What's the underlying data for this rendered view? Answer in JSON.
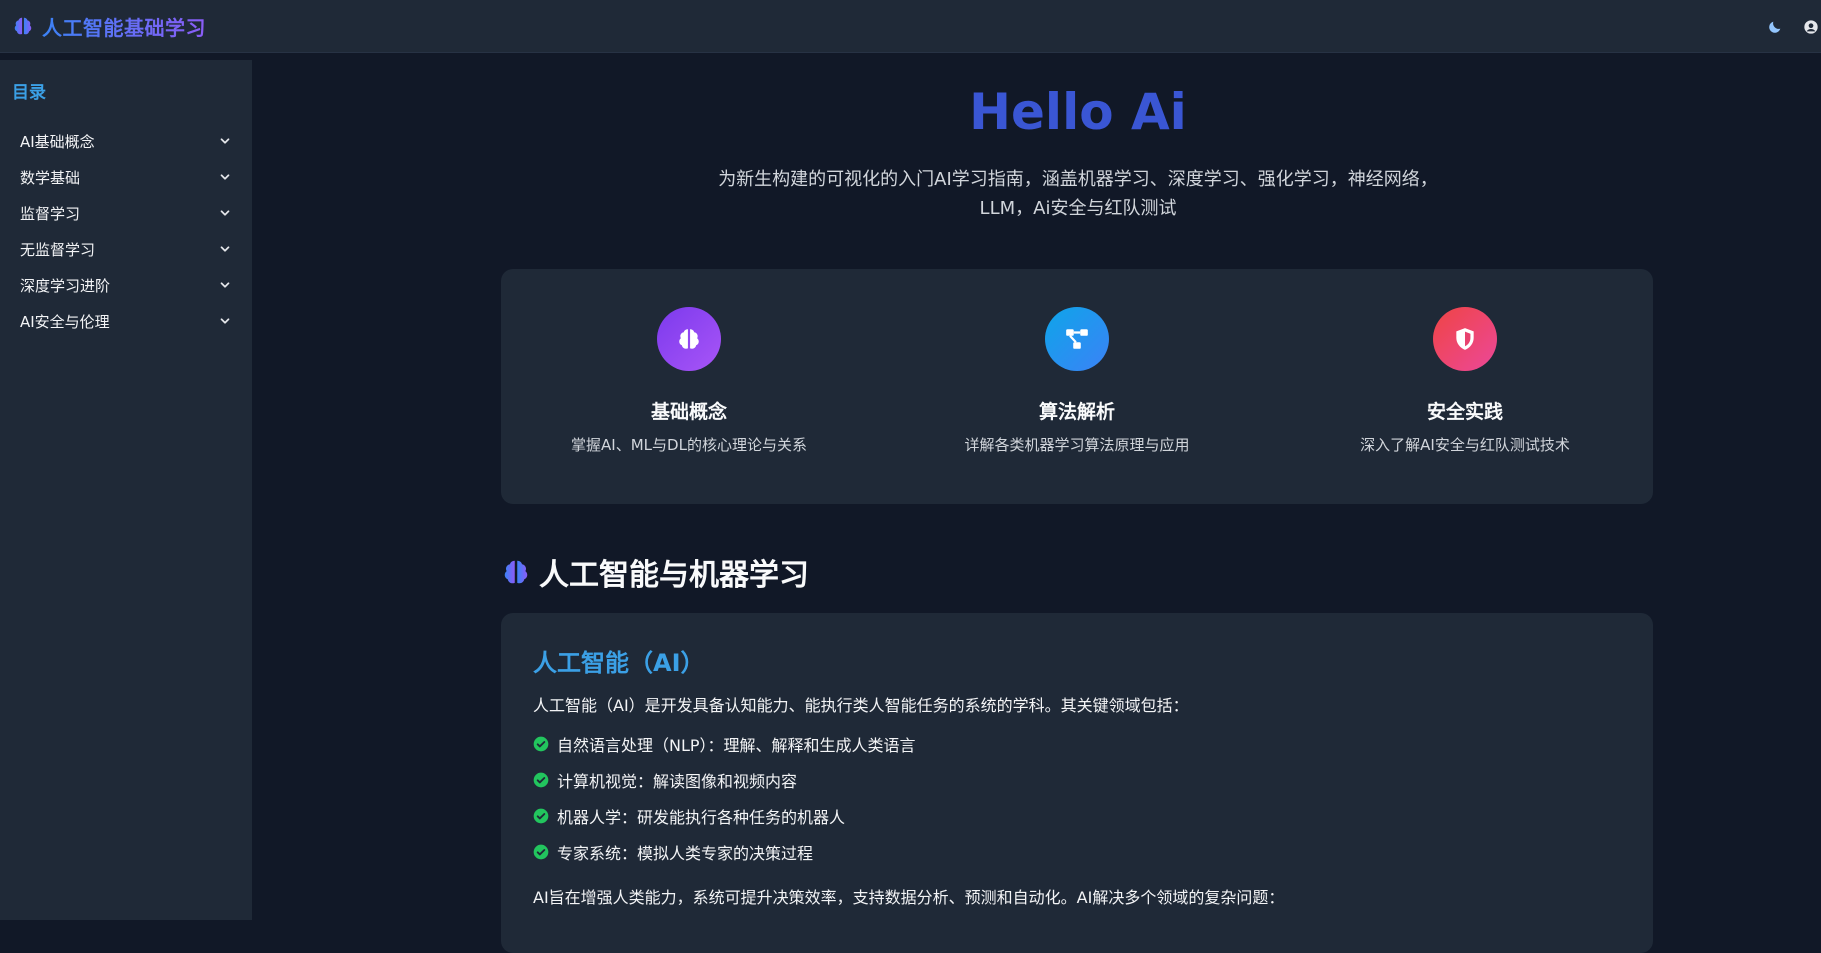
{
  "header": {
    "title": "人工智能基础学习",
    "brand_icon": "brain-icon",
    "actions": [
      "moon-icon",
      "user-icon"
    ]
  },
  "sidebar": {
    "title": "目录",
    "items": [
      {
        "label": "AI基础概念"
      },
      {
        "label": "数学基础"
      },
      {
        "label": "监督学习"
      },
      {
        "label": "无监督学习"
      },
      {
        "label": "深度学习进阶"
      },
      {
        "label": "AI安全与伦理"
      }
    ]
  },
  "hero": {
    "title": "Hello Ai",
    "subtitle_line1": "为新生构建的可视化的入门AI学习指南，涵盖机器学习、深度学习、强化学习，神经网络，",
    "subtitle_line2": "LLM，Ai安全与红队测试"
  },
  "features": [
    {
      "icon": "brain-icon",
      "title": "基础概念",
      "desc": "掌握AI、ML与DL的核心理论与关系"
    },
    {
      "icon": "algorithm-icon",
      "title": "算法解析",
      "desc": "详解各类机器学习算法原理与应用"
    },
    {
      "icon": "shield-icon",
      "title": "安全实践",
      "desc": "深入了解AI安全与红队测试技术"
    }
  ],
  "section": {
    "heading": "人工智能与机器学习"
  },
  "card": {
    "title": "人工智能（AI）",
    "intro": "人工智能（AI）是开发具备认知能力、能执行类人智能任务的系统的学科。其关键领域包括：",
    "items": [
      "自然语言处理（NLP）：理解、解释和生成人类语言",
      "计算机视觉：解读图像和视频内容",
      "机器人学：研发能执行各种任务的机器人",
      "专家系统：模拟人类专家的决策过程"
    ],
    "outro": "AI旨在增强人类能力，系统可提升决策效率，支持数据分析、预测和自动化。AI解决多个领域的复杂问题："
  },
  "colors": {
    "accent": "#3ba0e6",
    "hero": "#3a56d4",
    "check": "#22c55e"
  }
}
